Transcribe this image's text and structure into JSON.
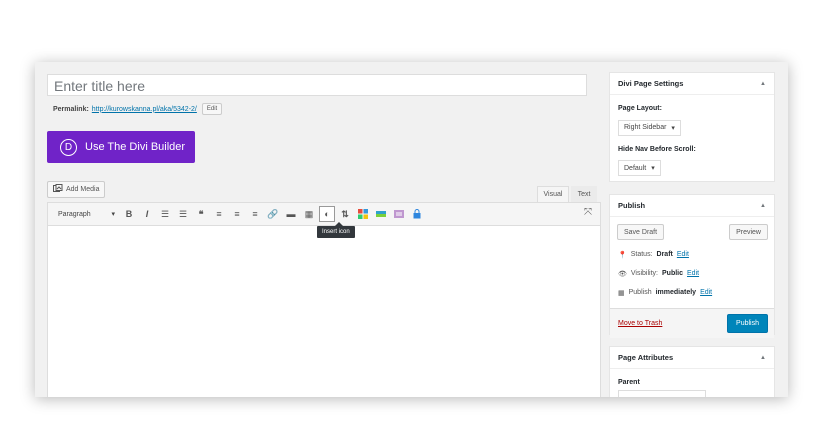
{
  "editor": {
    "title_placeholder": "Enter title here",
    "permalink_label": "Permalink:",
    "permalink_url": "http://kurowskanna.pl/aka/5342-2/",
    "permalink_edit": "Edit",
    "divi_button": "Use The Divi Builder",
    "divi_logo": "D",
    "add_media": "Add Media",
    "tab_visual": "Visual",
    "tab_text": "Text",
    "format_select": "Paragraph",
    "tooltip": "Insert icon",
    "toolbar_icons": [
      "bold-icon",
      "italic-icon",
      "bullet-list-icon",
      "numbered-list-icon",
      "blockquote-icon",
      "align-left-icon",
      "align-center-icon",
      "align-right-icon",
      "link-icon",
      "read-more-icon",
      "toolbar-toggle-icon",
      "insert-icon-icon",
      "shortcode-icon",
      "color-blocks-icon",
      "divider-icon",
      "list-block-icon",
      "lock-icon"
    ]
  },
  "divi_settings": {
    "heading": "Divi Page Settings",
    "layout_label": "Page Layout:",
    "layout_value": "Right Sidebar",
    "nav_label": "Hide Nav Before Scroll:",
    "nav_value": "Default"
  },
  "publish": {
    "heading": "Publish",
    "save_draft": "Save Draft",
    "preview": "Preview",
    "status_label": "Status:",
    "status_value": "Draft",
    "visibility_label": "Visibility:",
    "visibility_value": "Public",
    "publish_label": "Publish",
    "publish_value": "immediately",
    "edit": "Edit",
    "trash": "Move to Trash",
    "publish_button": "Publish"
  },
  "attributes": {
    "heading": "Page Attributes",
    "parent_label": "Parent"
  },
  "colors": {
    "divi_purple": "#7023c8",
    "publish_blue": "#0085ba",
    "link_blue": "#0073aa",
    "trash_red": "#a00"
  }
}
